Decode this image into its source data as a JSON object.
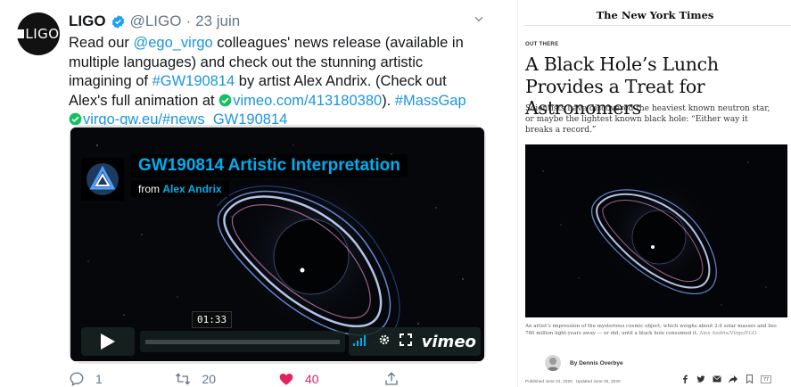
{
  "tweet": {
    "avatar_text": "LIGO",
    "name": "LIGO",
    "handle": "@LIGO",
    "dot": "·",
    "date": "23 juin",
    "body": {
      "t1": "Read our ",
      "mention": "@ego_virgo",
      "t2": " colleagues' news release (available in multiple languages) and check out the stunning artistic imagining of ",
      "hashtag1": "#GW190814",
      "t3": " by artist Alex Andrix. (Check out Alex's full animation at ",
      "link1": "vimeo.com/413180380",
      "t4": "). ",
      "hashtag2": "#MassGap",
      "link2": "virgo-gw.eu/#news_GW190814"
    },
    "video": {
      "title": "GW190814 Artistic Interpretation",
      "from_label": "from",
      "author": "Alex Andrix",
      "timecode": "01:33",
      "brand": "vimeo"
    },
    "actions": {
      "reply_count": "1",
      "retweet_count": "20",
      "like_count": "40"
    },
    "colors": {
      "link": "#1b95e0",
      "like": "#e0245e",
      "muted": "#657786"
    }
  },
  "nyt": {
    "masthead": "The New York Times",
    "kicker": "OUT THERE",
    "headline": "A Black Hole’s Lunch Provides a Treat for Astronomers",
    "dek": "Scientists have discovered the heaviest known neutron star, or maybe the lightest known black hole: “Either way it breaks a record.”",
    "caption": "An artist’s impression of the mysterious cosmic object, which weighs about 2.6 solar masses and lies 780 million light-years away — or did, until a black hole consumed it.",
    "credit": "Alex Andrix/Virgo/EGO",
    "byline": "By Dennis Overbye",
    "published": "Published June 24, 2020",
    "updated": "Updated June 25, 2020",
    "share_count": "77"
  }
}
